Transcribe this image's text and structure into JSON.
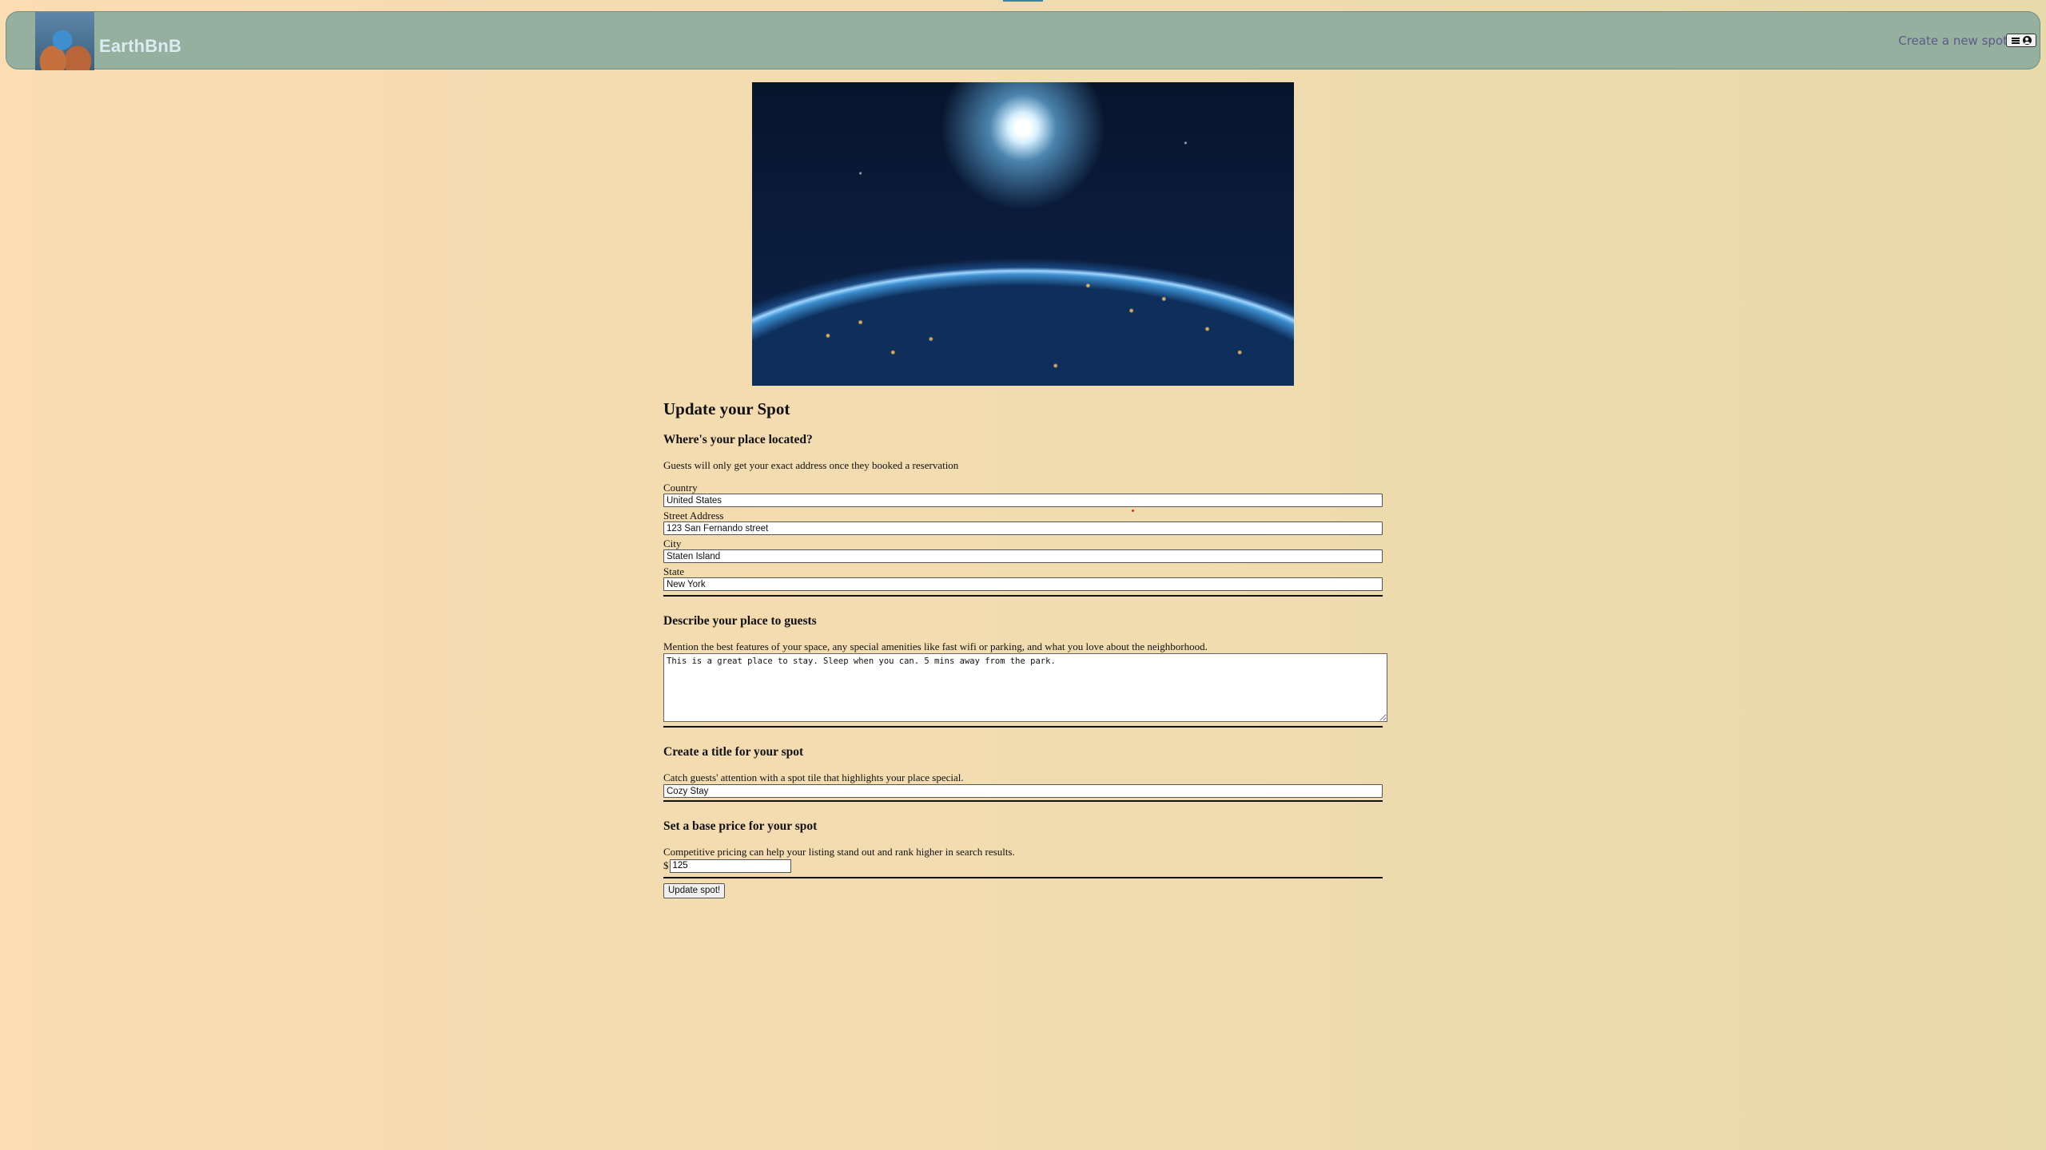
{
  "navbar": {
    "brand": "EarthBnB",
    "create_link": "Create a new spot",
    "logo_icon": "globe-hands-logo",
    "menu_icons": [
      "menu-icon",
      "user-circle-icon"
    ],
    "colors": {
      "nav_bg": "#96b0a0",
      "brand_text": "#d9ecf2",
      "link": "#5e5a86"
    }
  },
  "hero": {
    "image": "earth-from-space-image"
  },
  "form": {
    "title": "Update your Spot",
    "location": {
      "heading": "Where's your place located?",
      "description": "Guests will only get your exact address once they booked a reservation",
      "country_label": "Country",
      "country_value": "United States",
      "street_label": "Street Address",
      "street_value": "123 San Fernando street",
      "city_label": "City",
      "city_value": "Staten Island",
      "state_label": "State",
      "state_value": "New York"
    },
    "describe": {
      "heading": "Describe your place to guests",
      "description": "Mention the best features of your space, any special amenities like fast wifi or parking, and what you love about the neighborhood.",
      "value": "This is a great place to stay. Sleep when you can. 5 mins away from the park."
    },
    "title_section": {
      "heading": "Create a title for your spot",
      "description": "Catch guests' attention with a spot tile that highlights your place special.",
      "value": "Cozy Stay"
    },
    "price": {
      "heading": "Set a base price for your spot",
      "description": "Competitive pricing can help your listing stand out and rank higher in search results.",
      "currency": "$",
      "value": "125"
    },
    "submit_label": "Update spot!"
  }
}
